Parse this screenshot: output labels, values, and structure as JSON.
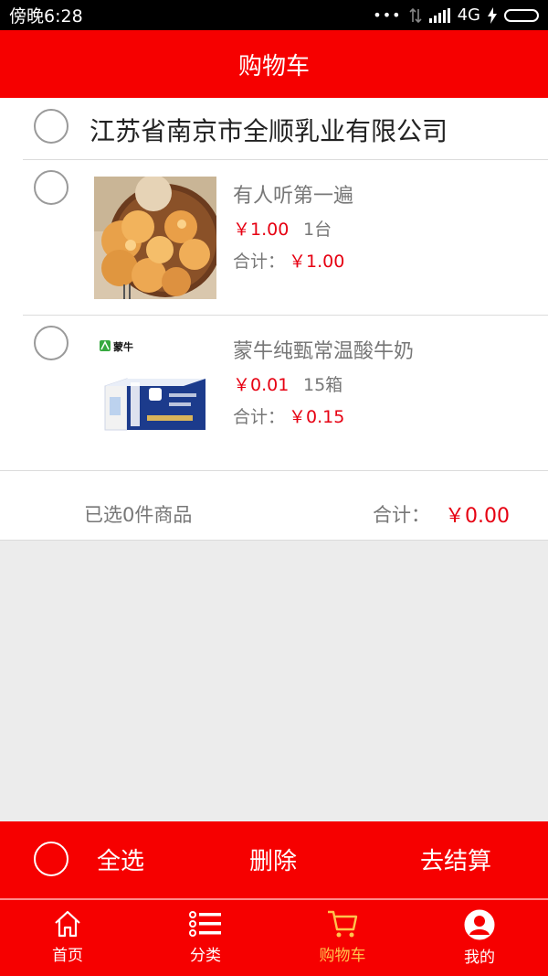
{
  "status_bar": {
    "time": "傍晚6:28",
    "network": "4G",
    "icons": [
      "more-dots-icon",
      "no-data-icon",
      "signal-icon",
      "charging-icon",
      "battery-icon"
    ]
  },
  "header": {
    "title": "购物车"
  },
  "shop": {
    "name": "江苏省南京市全顺乳业有限公司"
  },
  "items": [
    {
      "name": "有人听第一遍",
      "price": "￥1.00",
      "qty": "1台",
      "subtotal_label": "合计：",
      "subtotal": "￥1.00",
      "image": "pastry-photo"
    },
    {
      "name": "蒙牛纯甄常温酸牛奶",
      "price": "￥0.01",
      "qty": "15箱",
      "subtotal_label": "合计：",
      "subtotal": "￥0.15",
      "image": "mengniu-yogurt-box",
      "brand": "蒙牛"
    }
  ],
  "summary": {
    "selected": "已选0件商品",
    "total_label": "合计：",
    "total": "￥0.00"
  },
  "actions": {
    "select_all": "全选",
    "delete": "删除",
    "checkout": "去结算"
  },
  "tabs": [
    {
      "label": "首页",
      "icon": "home-icon"
    },
    {
      "label": "分类",
      "icon": "list-icon"
    },
    {
      "label": "购物车",
      "icon": "cart-icon",
      "active": true
    },
    {
      "label": "我的",
      "icon": "user-icon"
    }
  ],
  "colors": {
    "brand_red": "#f60000",
    "price_red": "#e60012",
    "active_tab": "#ffc34d"
  }
}
